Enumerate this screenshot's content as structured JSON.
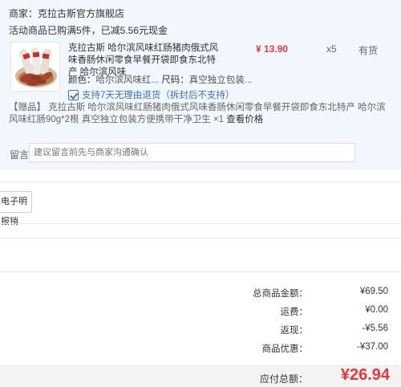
{
  "shop": {
    "label": "商家：",
    "name": "克拉古斯官方旗舰店"
  },
  "promo": {
    "text": "活动商品已购满5件，已减5.56元现金"
  },
  "product": {
    "title": "克拉古斯 哈尔滨风味红肠猪肉俄式风味香肠休闲零食早餐开袋即食东北特产 哈尔滨风味",
    "price": "¥ 13.90",
    "qty": "x5",
    "stock": "有货",
    "color_label": "颜色：",
    "color_value": "哈尔滨风味红...",
    "size_label": "尺码：",
    "size_value": "真空独立包装...",
    "service": "支持7天无理由退货（拆封后不支持）"
  },
  "gift": {
    "tag": "【赠品】",
    "text": "克拉古斯 哈尔滨风味红肠猪肉俄式风味香肠休闲零食早餐开袋即食东北特产 哈尔滨风味红肠90g*2根 真空独立包装方便携带干净卫生 ×1",
    "view_link": "查看价格"
  },
  "remark": {
    "label": "留言：",
    "placeholder": "建议留言前先与商家沟通确认"
  },
  "invoice": {
    "button": "电子明报销"
  },
  "summary": {
    "rows": [
      {
        "label": "总商品金额：",
        "value": "¥69.50"
      },
      {
        "label": "运费：",
        "value": "¥0.00"
      },
      {
        "label": "返现：",
        "value": "-¥5.56"
      },
      {
        "label": "商品优惠：",
        "value": "-¥37.00"
      }
    ],
    "total_label": "应付总额：",
    "total_value": "¥26.94"
  },
  "colors": {
    "accent": "#e4393c",
    "link": "#3c6fc4",
    "shop_bg": "#f2f7fd"
  }
}
